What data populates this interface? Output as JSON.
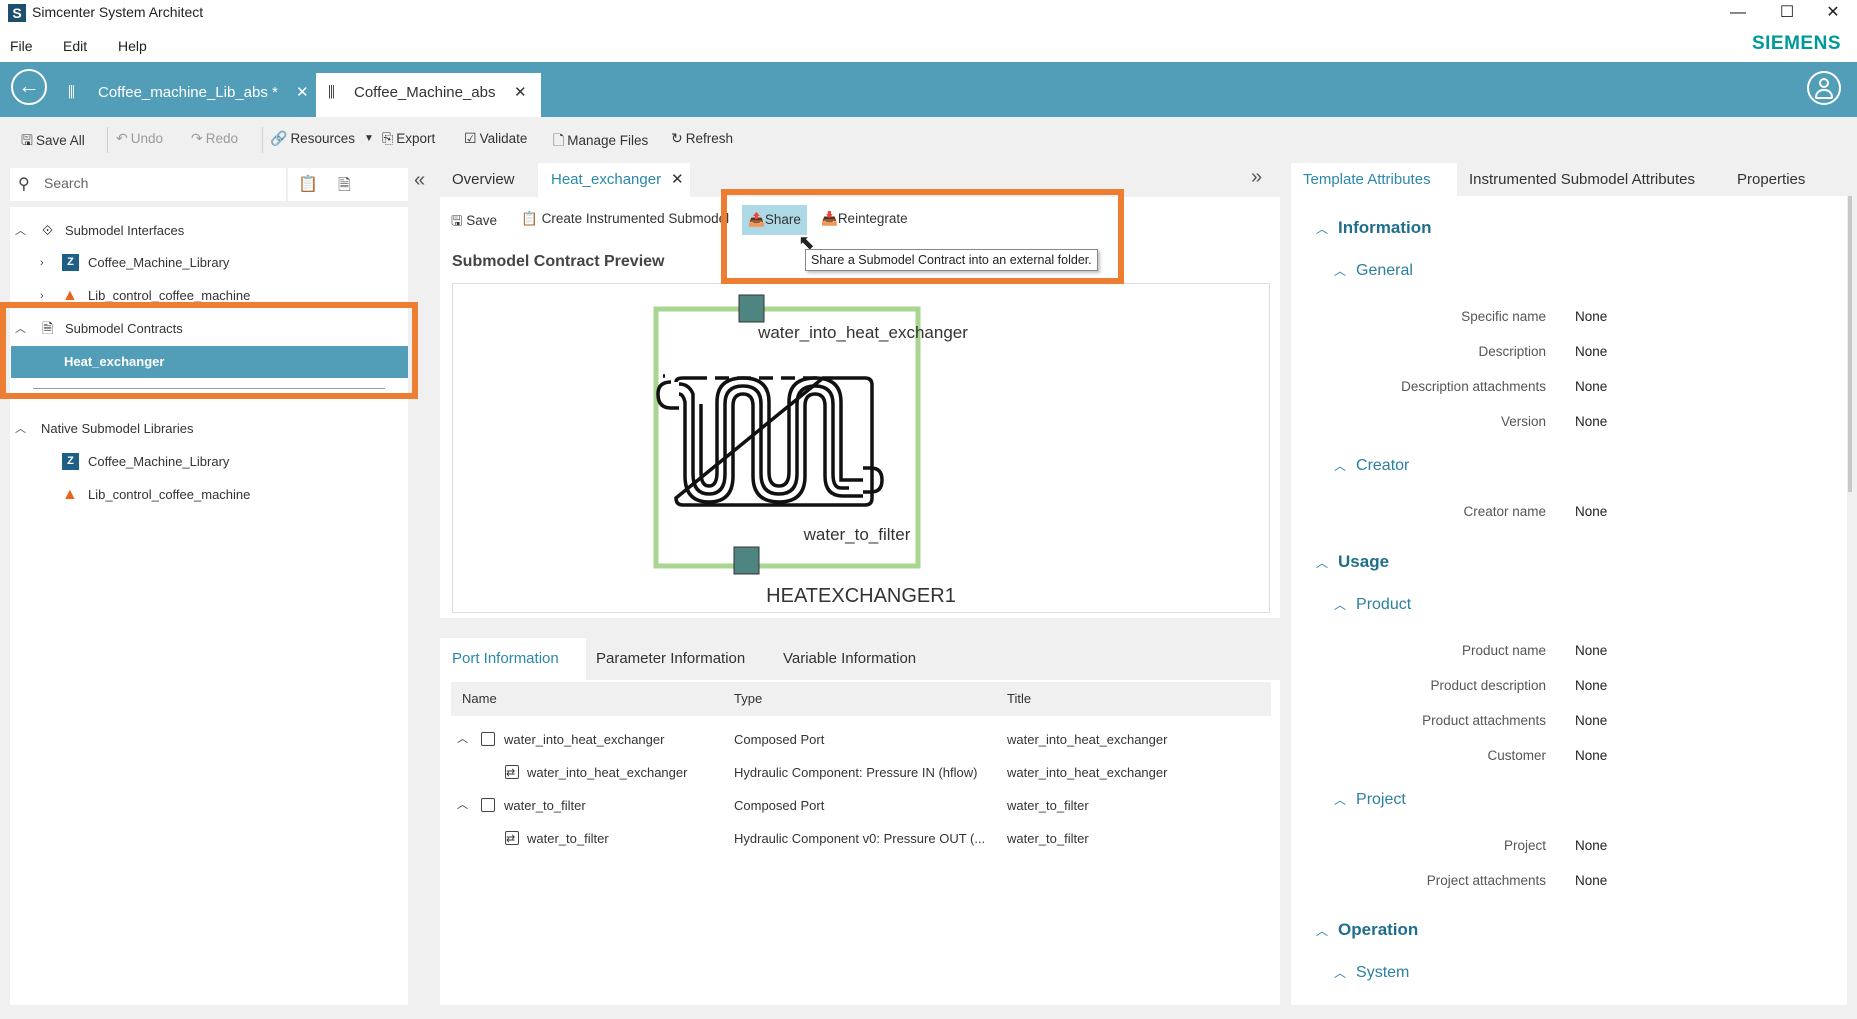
{
  "window": {
    "title": "Simcenter System Architect",
    "controls": {
      "minimize": "—",
      "maximize": "☐",
      "close": "✕"
    }
  },
  "menu": [
    "File",
    "Edit",
    "Help"
  ],
  "brand": "SIEMENS",
  "doc_tabs": [
    {
      "label": "Coffee_machine_Lib_abs *",
      "active": false,
      "close": "✕"
    },
    {
      "label": "Coffee_Machine_abs",
      "active": true,
      "close": "✕"
    }
  ],
  "toolbar": {
    "save_all": "Save All",
    "undo": "Undo",
    "redo": "Redo",
    "resources": "Resources",
    "export": "Export",
    "validate": "Validate",
    "manage_files": "Manage Files",
    "refresh": "Refresh"
  },
  "search": {
    "placeholder": "Search",
    "value": ""
  },
  "tree": {
    "submodel_interfaces": {
      "label": "Submodel Interfaces",
      "children": [
        "Coffee_Machine_Library",
        "Lib_control_coffee_machine"
      ]
    },
    "submodel_contracts": {
      "label": "Submodel Contracts",
      "children": [
        "Heat_exchanger"
      ],
      "selected": "Heat_exchanger"
    },
    "native_libraries": {
      "label": "Native Submodel Libraries",
      "children": [
        "Coffee_Machine_Library",
        "Lib_control_coffee_machine"
      ]
    }
  },
  "editor_tabs": [
    {
      "label": "Overview",
      "active": false
    },
    {
      "label": "Heat_exchanger",
      "active": true,
      "close": "✕"
    }
  ],
  "editor_toolbar": {
    "save": "Save",
    "create_instrumented": "Create Instrumented Submodel",
    "share": "Share",
    "reintegrate": "Reintegrate"
  },
  "tooltip": "Share a Submodel Contract into an external folder.",
  "preview": {
    "title": "Submodel Contract Preview",
    "port_top": "water_into_heat_exchanger",
    "port_bottom": "water_to_filter",
    "component_name": "HEATEXCHANGER1"
  },
  "bottom_tabs": [
    {
      "label": "Port Information",
      "active": true
    },
    {
      "label": "Parameter Information",
      "active": false
    },
    {
      "label": "Variable Information",
      "active": false
    }
  ],
  "port_table": {
    "columns": [
      "Name",
      "Type",
      "Title"
    ],
    "rows": [
      {
        "level": 0,
        "name": "water_into_heat_exchanger",
        "type": "Composed Port",
        "title": "water_into_heat_exchanger"
      },
      {
        "level": 1,
        "name": "water_into_heat_exchanger",
        "type": "Hydraulic Component: Pressure IN (hflow)",
        "title": "water_into_heat_exchanger"
      },
      {
        "level": 0,
        "name": "water_to_filter",
        "type": "Composed Port",
        "title": "water_to_filter"
      },
      {
        "level": 1,
        "name": "water_to_filter",
        "type": "Hydraulic Component v0: Pressure OUT (...",
        "title": "water_to_filter"
      }
    ]
  },
  "right_tabs": [
    {
      "label": "Template Attributes",
      "active": true
    },
    {
      "label": "Instrumented Submodel Attributes",
      "active": false
    },
    {
      "label": "Properties",
      "active": false
    }
  ],
  "attributes": {
    "information": {
      "label": "Information",
      "general": {
        "label": "General",
        "fields": [
          {
            "label": "Specific name",
            "value": "None"
          },
          {
            "label": "Description",
            "value": "None"
          },
          {
            "label": "Description attachments",
            "value": "None"
          },
          {
            "label": "Version",
            "value": "None"
          }
        ]
      },
      "creator": {
        "label": "Creator",
        "fields": [
          {
            "label": "Creator name",
            "value": "None"
          }
        ]
      }
    },
    "usage": {
      "label": "Usage",
      "product": {
        "label": "Product",
        "fields": [
          {
            "label": "Product name",
            "value": "None"
          },
          {
            "label": "Product description",
            "value": "None"
          },
          {
            "label": "Product attachments",
            "value": "None"
          },
          {
            "label": "Customer",
            "value": "None"
          }
        ]
      },
      "project": {
        "label": "Project",
        "fields": [
          {
            "label": "Project",
            "value": "None"
          },
          {
            "label": "Project attachments",
            "value": "None"
          }
        ]
      }
    },
    "operation": {
      "label": "Operation",
      "system": {
        "label": "System"
      }
    }
  },
  "colors": {
    "accent": "#529eb8",
    "highlight": "#ed7d31",
    "link": "#2b88aa",
    "brand": "#009999",
    "block_border": "#a8d58f",
    "port_fill": "#4f8580"
  }
}
